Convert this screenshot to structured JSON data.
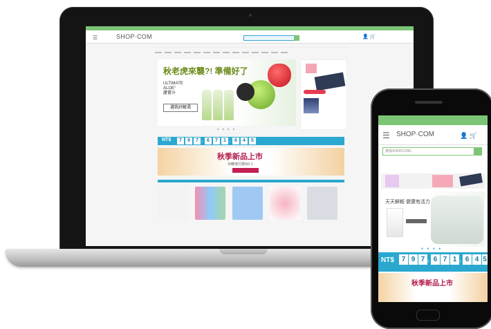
{
  "desktop": {
    "top_bar": "",
    "logo": "SHOP·COM",
    "logo_sub": "",
    "search_placeholder": "",
    "menu_icon": "hamburger-icon",
    "icons": "👤 🛒",
    "note_left": "",
    "note_right": "",
    "banner": {
      "headline": "秋老虎來襲?! 準備好了",
      "subtitle": "ULTIMATE\nALOE°\n蘆薈汁",
      "button": "選我好解渴",
      "dots": "● ● ● ●"
    },
    "side_pill": "",
    "counter": {
      "label": "NT$",
      "digits": [
        "7",
        "9",
        "7",
        ",",
        "6",
        "7",
        "1",
        ",",
        "6",
        "4",
        "5"
      ],
      "right_text": ""
    },
    "fall_sale": {
      "title": "秋季新品上市",
      "subtitle": "日韓流行款NO.1",
      "button": ""
    },
    "strip_title": "",
    "products": [
      "#7b5a2b",
      "#f48fb1",
      "#9fc9f2",
      "#f6b4c2",
      "#d9dde3"
    ]
  },
  "mobile": {
    "top_bar": "",
    "logo": "SHOP·COM",
    "search_placeholder": "搜尋SHOP.COM...",
    "note": "",
    "hero_title": "天天鮮輕 健康有活力",
    "hero_tag": "",
    "dots": "● ● ● ●",
    "counter": {
      "label": "NT$",
      "digits": [
        "7",
        "9",
        "7",
        ",",
        "6",
        "7",
        "1",
        ",",
        "6",
        "4",
        "5"
      ],
      "right_text": ""
    },
    "fall_title": "秋季新品上市"
  }
}
